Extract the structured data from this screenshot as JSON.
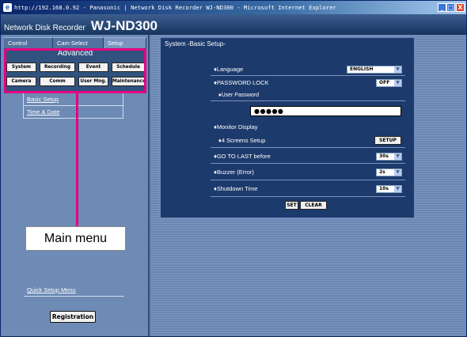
{
  "window": {
    "title": "http://192.168.0.92 - Panasonic | Network Disk Recorder WJ-ND300 - Microsoft Internet Explorer",
    "icon": "ie-icon",
    "min": "_",
    "max": "□",
    "close": "X"
  },
  "header": {
    "product_type": "Network Disk Recorder",
    "model": "WJ-ND300"
  },
  "tabs": [
    "Control",
    "Cam Select",
    "Setup"
  ],
  "advanced": {
    "title": "Advanced",
    "buttons": [
      "System",
      "Recording",
      "Event",
      "Schedule",
      "Camera",
      "Comm",
      "User Mng.",
      "Maintenance"
    ]
  },
  "sidebar": {
    "links": [
      "Basic Setup",
      "Time & Date"
    ],
    "quick_setup": "Quick Setup Menu",
    "registration": "Registration"
  },
  "callout": "Main menu",
  "panel": {
    "title": "System -Basic Setup-",
    "language": {
      "label": "♦Language",
      "value": "ENGLISH"
    },
    "password_lock": {
      "label": "♦PASSWORD LOCK",
      "value": "OFF"
    },
    "user_password": {
      "label": "♦User Password",
      "value": "●●●●●"
    },
    "monitor_display": {
      "label": "♦Monitor Display"
    },
    "four_screens": {
      "label": "♦4 Screens Setup",
      "button": "SETUP"
    },
    "go_to_last": {
      "label": "♦GO TO LAST before",
      "value": "30s"
    },
    "buzzer": {
      "label": "♦Buzzer (Error)",
      "value": "2s"
    },
    "shutdown": {
      "label": "♦Shutdown Time",
      "value": "10s"
    },
    "set": "SET",
    "clear": "CLEAR"
  },
  "colors": {
    "highlight": "#e5007f",
    "panel": "#1d3a6c",
    "sidebar": "#6e8bb5"
  }
}
